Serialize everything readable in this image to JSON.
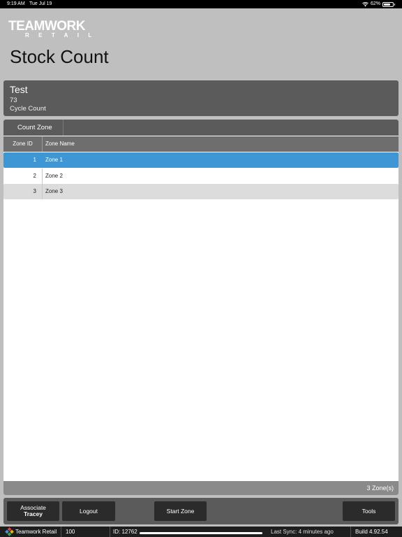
{
  "status": {
    "time": "9:19 AM",
    "date": "Tue Jul 19",
    "battery": "62%"
  },
  "logo": {
    "line1": "TEAMWORK",
    "line2": "RETAIL"
  },
  "page_title": "Stock Count",
  "count_info": {
    "name": "Test",
    "number": "73",
    "type": "Cycle Count"
  },
  "tab": {
    "label": "Count Zone"
  },
  "table": {
    "headers": {
      "zone_id": "Zone ID",
      "zone_name": "Zone Name"
    },
    "rows": [
      {
        "id": "1",
        "name": "Zone 1"
      },
      {
        "id": "2",
        "name": "Zone 2"
      },
      {
        "id": "3",
        "name": "Zone 3"
      }
    ],
    "selected_index": 0
  },
  "footer": {
    "summary": "3 Zone(s)"
  },
  "toolbar": {
    "associate_label": "Associate",
    "associate_name": "Tracey",
    "logout_label": "Logout",
    "start_zone_label": "Start Zone",
    "tools_label": "Tools"
  },
  "bottombar": {
    "app_name": "Teamwork Retail",
    "store": "100",
    "id": "ID: 12762",
    "last_sync": "Last Sync: 4 minutes ago",
    "build": "Build 4.92.54"
  },
  "colors": {
    "selected_row": "#3f96d4",
    "panel_header": "#5b5b5b",
    "background": "#bfbfbf"
  }
}
